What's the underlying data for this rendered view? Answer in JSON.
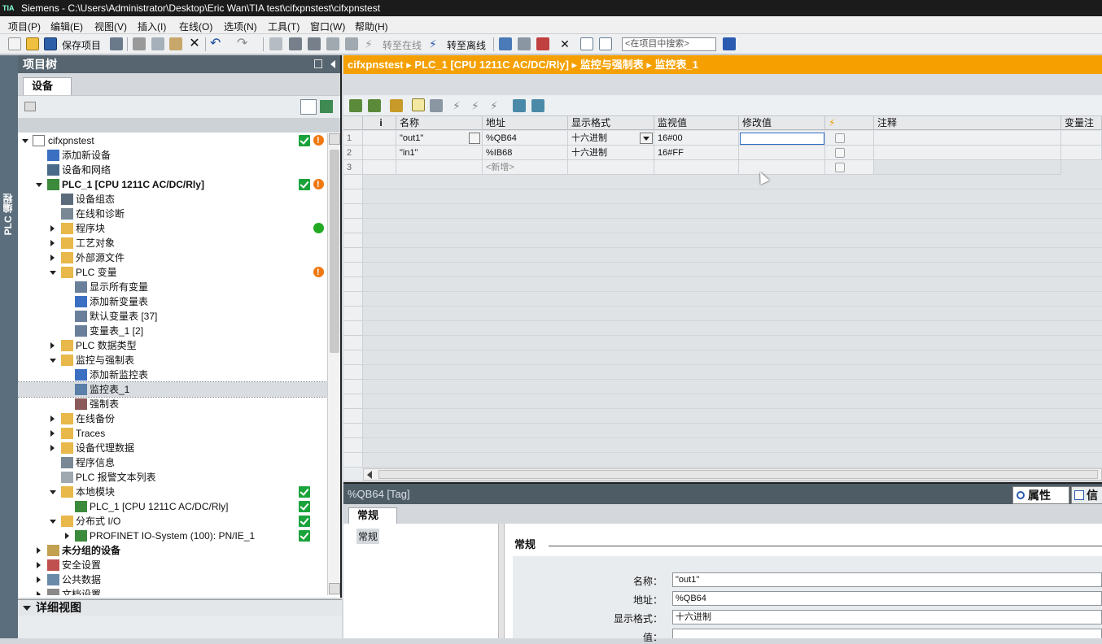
{
  "title_bar": {
    "logo": "TIA",
    "text": "Siemens  -  C:\\Users\\Administrator\\Desktop\\Eric Wan\\TIA test\\cifxpnstest\\cifxpnstest"
  },
  "menu": [
    "项目(P)",
    "编辑(E)",
    "视图(V)",
    "插入(I)",
    "在线(O)",
    "选项(N)",
    "工具(T)",
    "窗口(W)",
    "帮助(H)"
  ],
  "toolbar": {
    "save_label": "保存项目",
    "go_online": "转至在线",
    "go_offline": "转至离线",
    "search_placeholder": "<在项目中搜索>"
  },
  "side_strip": {
    "label": "PLC 编程"
  },
  "project_tree": {
    "header": "项目树",
    "tab": "设备",
    "items": [
      {
        "label": "cifxpnstest"
      },
      {
        "label": "添加新设备"
      },
      {
        "label": "设备和网络"
      },
      {
        "label": "PLC_1 [CPU 1211C AC/DC/Rly]"
      },
      {
        "label": "设备组态"
      },
      {
        "label": "在线和诊断"
      },
      {
        "label": "程序块"
      },
      {
        "label": "工艺对象"
      },
      {
        "label": "外部源文件"
      },
      {
        "label": "PLC 变量"
      },
      {
        "label": "显示所有变量"
      },
      {
        "label": "添加新变量表"
      },
      {
        "label": "默认变量表 [37]"
      },
      {
        "label": "变量表_1 [2]"
      },
      {
        "label": "PLC 数据类型"
      },
      {
        "label": "监控与强制表"
      },
      {
        "label": "添加新监控表"
      },
      {
        "label": "监控表_1"
      },
      {
        "label": "强制表"
      },
      {
        "label": "在线备份"
      },
      {
        "label": "Traces"
      },
      {
        "label": "设备代理数据"
      },
      {
        "label": "程序信息"
      },
      {
        "label": "PLC 报警文本列表"
      },
      {
        "label": "本地模块"
      },
      {
        "label": "PLC_1 [CPU 1211C AC/DC/Rly]"
      },
      {
        "label": "分布式 I/O"
      },
      {
        "label": "PROFINET IO-System (100): PN/IE_1"
      },
      {
        "label": "未分组的设备"
      },
      {
        "label": "安全设置"
      },
      {
        "label": "公共数据"
      },
      {
        "label": "文档设置"
      }
    ]
  },
  "detail_view": {
    "label": "详细视图"
  },
  "breadcrumb": [
    "cifxpnstest",
    "PLC_1 [CPU 1211C AC/DC/Rly]",
    "监控与强制表",
    "监控表_1"
  ],
  "watch_table": {
    "columns": [
      "i",
      "名称",
      "地址",
      "显示格式",
      "监视值",
      "修改值",
      "⚡",
      "注释",
      "变量注释"
    ],
    "rows": [
      {
        "num": "1",
        "name": "\"out1\"",
        "address": "%QB64",
        "format": "十六进制",
        "monitor": "16#00",
        "modify": ""
      },
      {
        "num": "2",
        "name": "\"in1\"",
        "address": "%IB68",
        "format": "十六进制",
        "monitor": "16#FF",
        "modify": ""
      },
      {
        "num": "3",
        "name": "",
        "address": "<新增>",
        "format": "",
        "monitor": "",
        "modify": ""
      }
    ]
  },
  "inspector": {
    "title": "%QB64 [Tag]",
    "tab_properties": "属性",
    "tab_info": "信息",
    "tab_general": "常规",
    "nav_general": "常规",
    "section_title": "常规",
    "fields": [
      {
        "label": "名称：",
        "value": "\"out1\""
      },
      {
        "label": "地址：",
        "value": "%QB64"
      },
      {
        "label": "显示格式：",
        "value": "十六进制"
      },
      {
        "label": "值：",
        "value": ""
      }
    ]
  }
}
